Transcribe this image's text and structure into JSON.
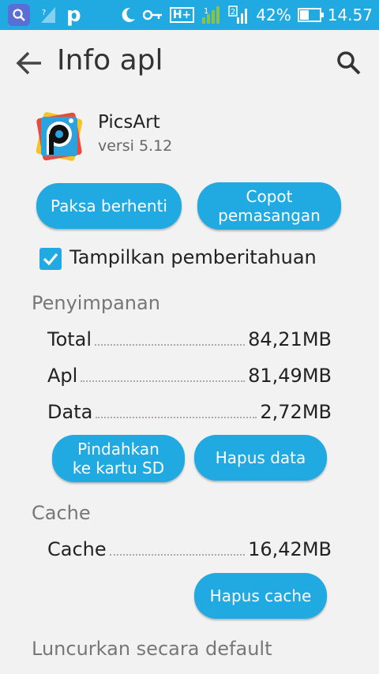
{
  "statusbar": {
    "battery": "42%",
    "time": "14.57",
    "network": "H+",
    "battery_level": 0.42,
    "icons": [
      "search-icon",
      "no-signal-icon",
      "p-app-icon",
      "moon-icon",
      "key-icon",
      "sim1-signal-icon",
      "sim2-signal-icon",
      "battery-icon"
    ]
  },
  "appbar": {
    "title": "Info apl"
  },
  "app": {
    "name": "PicsArt",
    "version": "versi 5.12"
  },
  "buttons": {
    "force_stop": "Paksa berhenti",
    "uninstall": "Copot\npemasangan",
    "move_sd": "Pindahkan\nke kartu SD",
    "clear_data": "Hapus data",
    "clear_cache": "Hapus cache"
  },
  "notification": {
    "label": "Tampilkan pemberitahuan",
    "checked": true
  },
  "storage": {
    "heading": "Penyimpanan",
    "rows": [
      {
        "label": "Total",
        "value": "84,21MB"
      },
      {
        "label": "Apl",
        "value": "81,49MB"
      },
      {
        "label": "Data",
        "value": "2,72MB"
      }
    ]
  },
  "cache": {
    "heading": "Cache",
    "rows": [
      {
        "label": "Cache",
        "value": "16,42MB"
      }
    ]
  },
  "launch": {
    "heading": "Luncurkan secara default"
  },
  "colors": {
    "accent": "#21a9e1",
    "background": "#f2f2f2"
  }
}
